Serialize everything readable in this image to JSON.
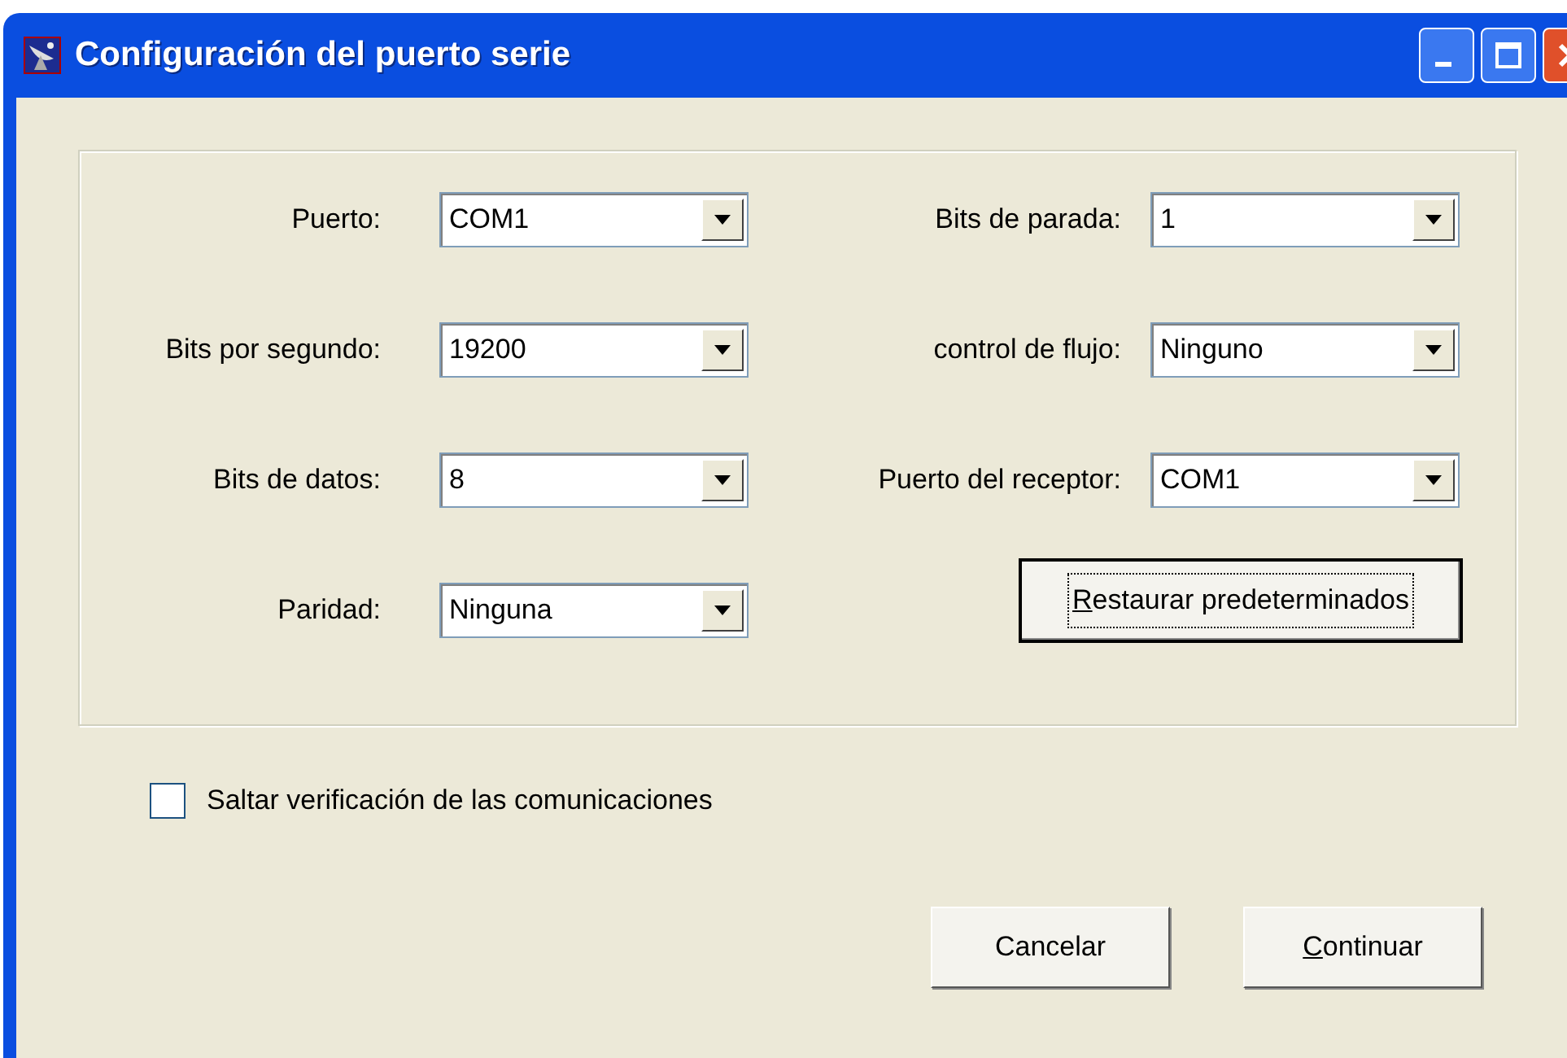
{
  "window": {
    "title": "Configuración del puerto serie"
  },
  "left_fields": [
    {
      "label": "Puerto:",
      "value": "COM1"
    },
    {
      "label": "Bits por segundo:",
      "value": "19200"
    },
    {
      "label": "Bits de datos:",
      "value": "8"
    },
    {
      "label": "Paridad:",
      "value": "Ninguna"
    }
  ],
  "right_fields": [
    {
      "label": "Bits de parada:",
      "value": "1"
    },
    {
      "label": "control de flujo:",
      "value": "Ninguno"
    },
    {
      "label": "Puerto del receptor:",
      "value": "COM1"
    }
  ],
  "restore_button": {
    "label": "Restaurar predeterminados",
    "focused": true,
    "underline_first": true
  },
  "skip_check": {
    "label": "Saltar verificación de las comunicaciones",
    "checked": false
  },
  "buttons": [
    {
      "label": "Cancelar",
      "underline_first": false
    },
    {
      "label": "Continuar",
      "underline_first": true
    }
  ]
}
